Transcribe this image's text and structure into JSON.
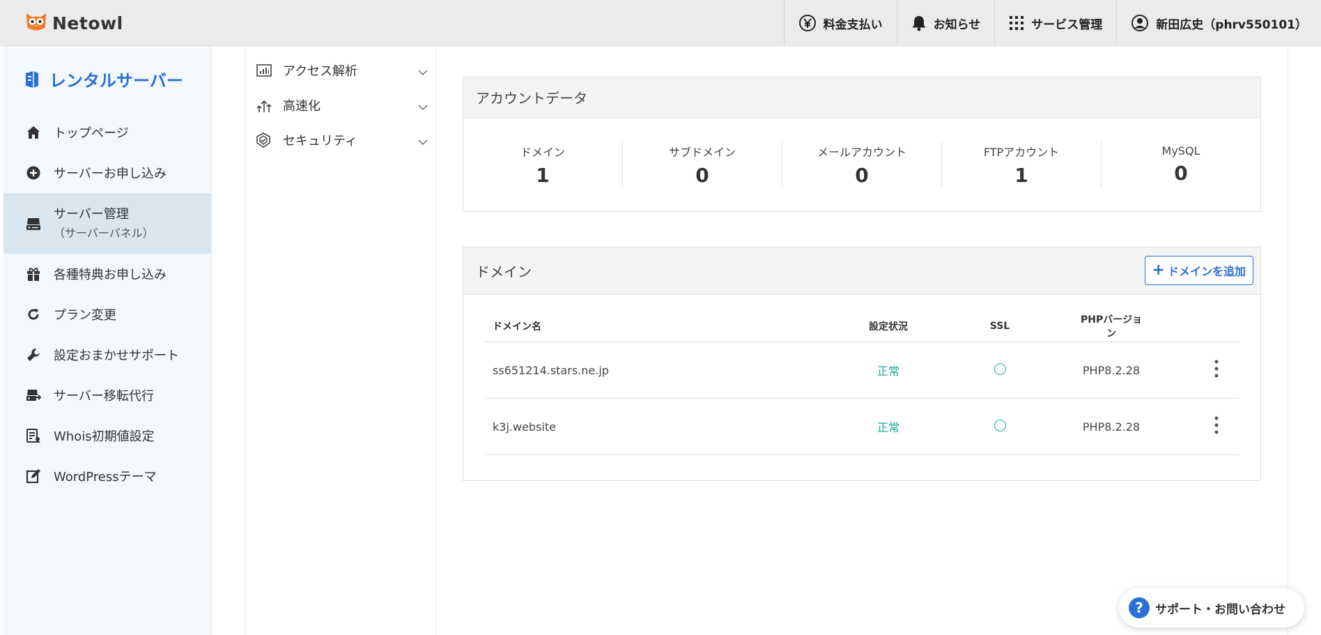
{
  "header": {
    "brand": "Netowl",
    "nav": [
      {
        "label": "料金支払い",
        "icon": "yen-icon"
      },
      {
        "label": "お知らせ",
        "icon": "bell-icon"
      },
      {
        "label": "サービス管理",
        "icon": "grid-icon"
      },
      {
        "label": "新田広史（phrv550101）",
        "icon": "user-icon"
      }
    ]
  },
  "sidebar": {
    "title": "レンタルサーバー",
    "items": [
      {
        "label": "トップページ",
        "icon": "home-icon"
      },
      {
        "label": "サーバーお申し込み",
        "icon": "plus-circle-icon"
      },
      {
        "label": "サーバー管理",
        "sub": "（サーバーパネル）",
        "icon": "server-icon",
        "active": true
      },
      {
        "label": "各種特典お申し込み",
        "icon": "gift-icon"
      },
      {
        "label": "プラン変更",
        "icon": "refresh-icon"
      },
      {
        "label": "設定おまかせサポート",
        "icon": "wrench-icon"
      },
      {
        "label": "サーバー移転代行",
        "icon": "server-transfer-icon"
      },
      {
        "label": "Whois初期値設定",
        "icon": "whois-icon"
      },
      {
        "label": "WordPressテーマ",
        "icon": "edit-icon"
      }
    ]
  },
  "subnav": {
    "items": [
      {
        "label": "アクセス解析",
        "icon": "chart-icon"
      },
      {
        "label": "高速化",
        "icon": "speed-icon"
      },
      {
        "label": "セキュリティ",
        "icon": "shield-icon"
      }
    ]
  },
  "account": {
    "title": "アカウントデータ",
    "stats": [
      {
        "label": "ドメイン",
        "value": "1"
      },
      {
        "label": "サブドメイン",
        "value": "0"
      },
      {
        "label": "メールアカウント",
        "value": "0"
      },
      {
        "label": "FTPアカウント",
        "value": "1"
      },
      {
        "label": "MySQL",
        "value": "0"
      }
    ]
  },
  "domains": {
    "title": "ドメイン",
    "add_label": "ドメインを追加",
    "columns": {
      "name": "ドメイン名",
      "status": "設定状況",
      "ssl": "SSL",
      "php": "PHPバージョン"
    },
    "rows": [
      {
        "name": "ss651214.stars.ne.jp",
        "status": "正常",
        "php": "PHP8.2.28"
      },
      {
        "name": "k3j.website",
        "status": "正常",
        "php": "PHP8.2.28"
      }
    ]
  },
  "support": {
    "label": "サポート・お問い合わせ"
  },
  "colors": {
    "accent": "#2a6fd6",
    "ok": "#1aa89a"
  }
}
